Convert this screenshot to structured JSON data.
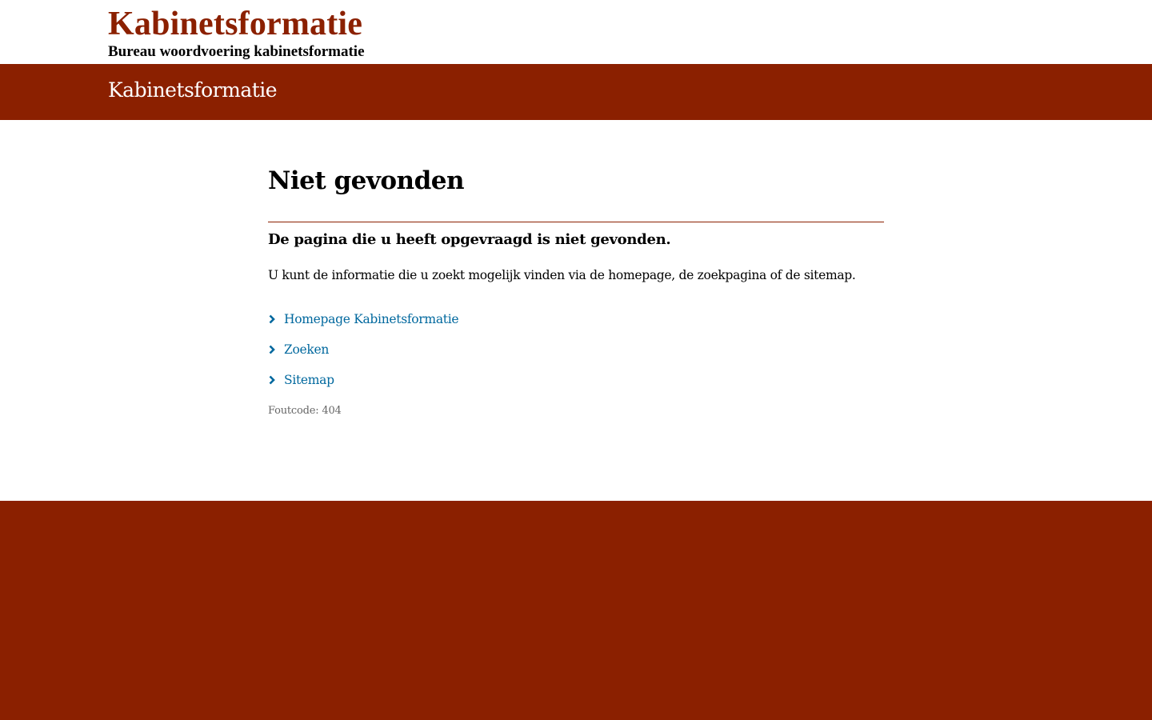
{
  "header": {
    "logo_title": "Kabinetsformatie",
    "logo_subtitle": "Bureau woordvoering kabinetsformatie"
  },
  "banner": {
    "title": "Kabinetsformatie"
  },
  "main": {
    "title": "Niet gevonden",
    "lead": "De pagina die u heeft opgevraagd is niet gevonden.",
    "intro": "U kunt de informatie die u zoekt mogelijk vinden via de homepage, de zoekpagina of de sitemap.",
    "links": [
      {
        "label": "Homepage Kabinetsformatie",
        "icon": "chevron-right-icon"
      },
      {
        "label": "Zoeken",
        "icon": "chevron-right-icon"
      },
      {
        "label": "Sitemap",
        "icon": "chevron-right-icon"
      }
    ],
    "error_code": "Foutcode: 404"
  },
  "colors": {
    "brand": "#8b2000",
    "link": "#00689e",
    "muted": "#666666"
  }
}
